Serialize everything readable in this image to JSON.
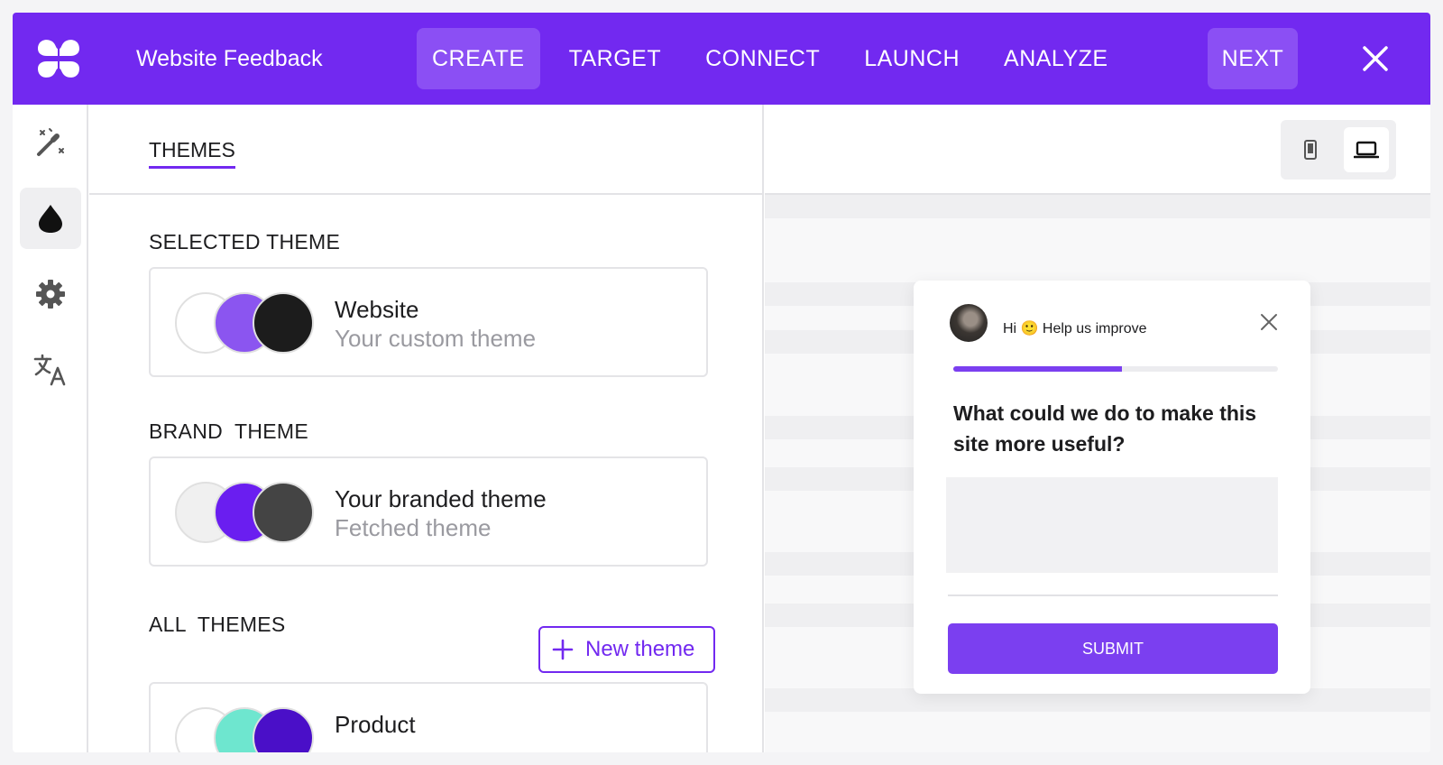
{
  "header": {
    "title": "Website Feedback",
    "tabs": [
      {
        "label": "CREATE",
        "active": true
      },
      {
        "label": "TARGET"
      },
      {
        "label": "CONNECT"
      },
      {
        "label": "LAUNCH"
      },
      {
        "label": "ANALYZE"
      }
    ],
    "next_label": "NEXT"
  },
  "rail": {
    "items": [
      {
        "icon": "magic-wand-icon"
      },
      {
        "icon": "drop-icon",
        "active": true
      },
      {
        "icon": "gear-icon"
      },
      {
        "icon": "translate-icon"
      }
    ]
  },
  "panel": {
    "tab_label": "THEMES",
    "selected": {
      "label": "SELECTED THEME",
      "theme": {
        "name": "Website",
        "sub": "Your custom theme",
        "colors": [
          "#ffffff",
          "#8b55f0",
          "#1c1c1c"
        ]
      }
    },
    "brand": {
      "label": "BRAND  THEME",
      "theme": {
        "name": "Your branded theme",
        "sub": "Fetched theme",
        "colors": [
          "#f0f0f0",
          "#6a1ef0",
          "#444444"
        ]
      }
    },
    "all": {
      "label": "ALL  THEMES",
      "new_theme_label": "New theme",
      "themes": [
        {
          "name": "Product",
          "colors": [
            "#ffffff",
            "#6ee6cf",
            "#4a0fc8"
          ]
        }
      ]
    }
  },
  "preview": {
    "device_toggle": [
      {
        "icon": "mobile-icon"
      },
      {
        "icon": "laptop-icon",
        "active": true
      }
    ],
    "widget": {
      "greeting": "Hi 🙂 Help us improve",
      "progress": 0.52,
      "question": "What could we do to make this site more useful?",
      "answer_value": "",
      "submit_label": "SUBMIT"
    }
  },
  "colors": {
    "brand": "#7229f0",
    "accent": "#7b3ff0"
  }
}
